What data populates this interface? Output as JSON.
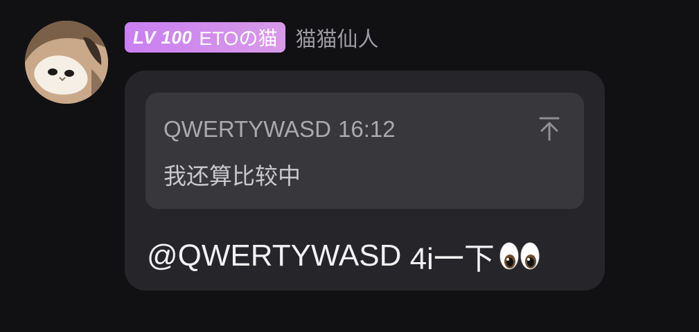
{
  "sender": {
    "avatar_icon": "cat-avatar-icon",
    "badge": {
      "level": "LV 100",
      "title": "ETOの猫",
      "color": "#cf86ee"
    },
    "nickname": "猫猫仙人"
  },
  "message": {
    "quote": {
      "author": "QWERTYWASD",
      "time": "16:12",
      "text": "我还算比较中",
      "jump_icon": "jump-to-top-icon"
    },
    "mention": "@QWERTYWASD",
    "body": " 4i一下",
    "emoji": "eyes-emoji-icon"
  }
}
